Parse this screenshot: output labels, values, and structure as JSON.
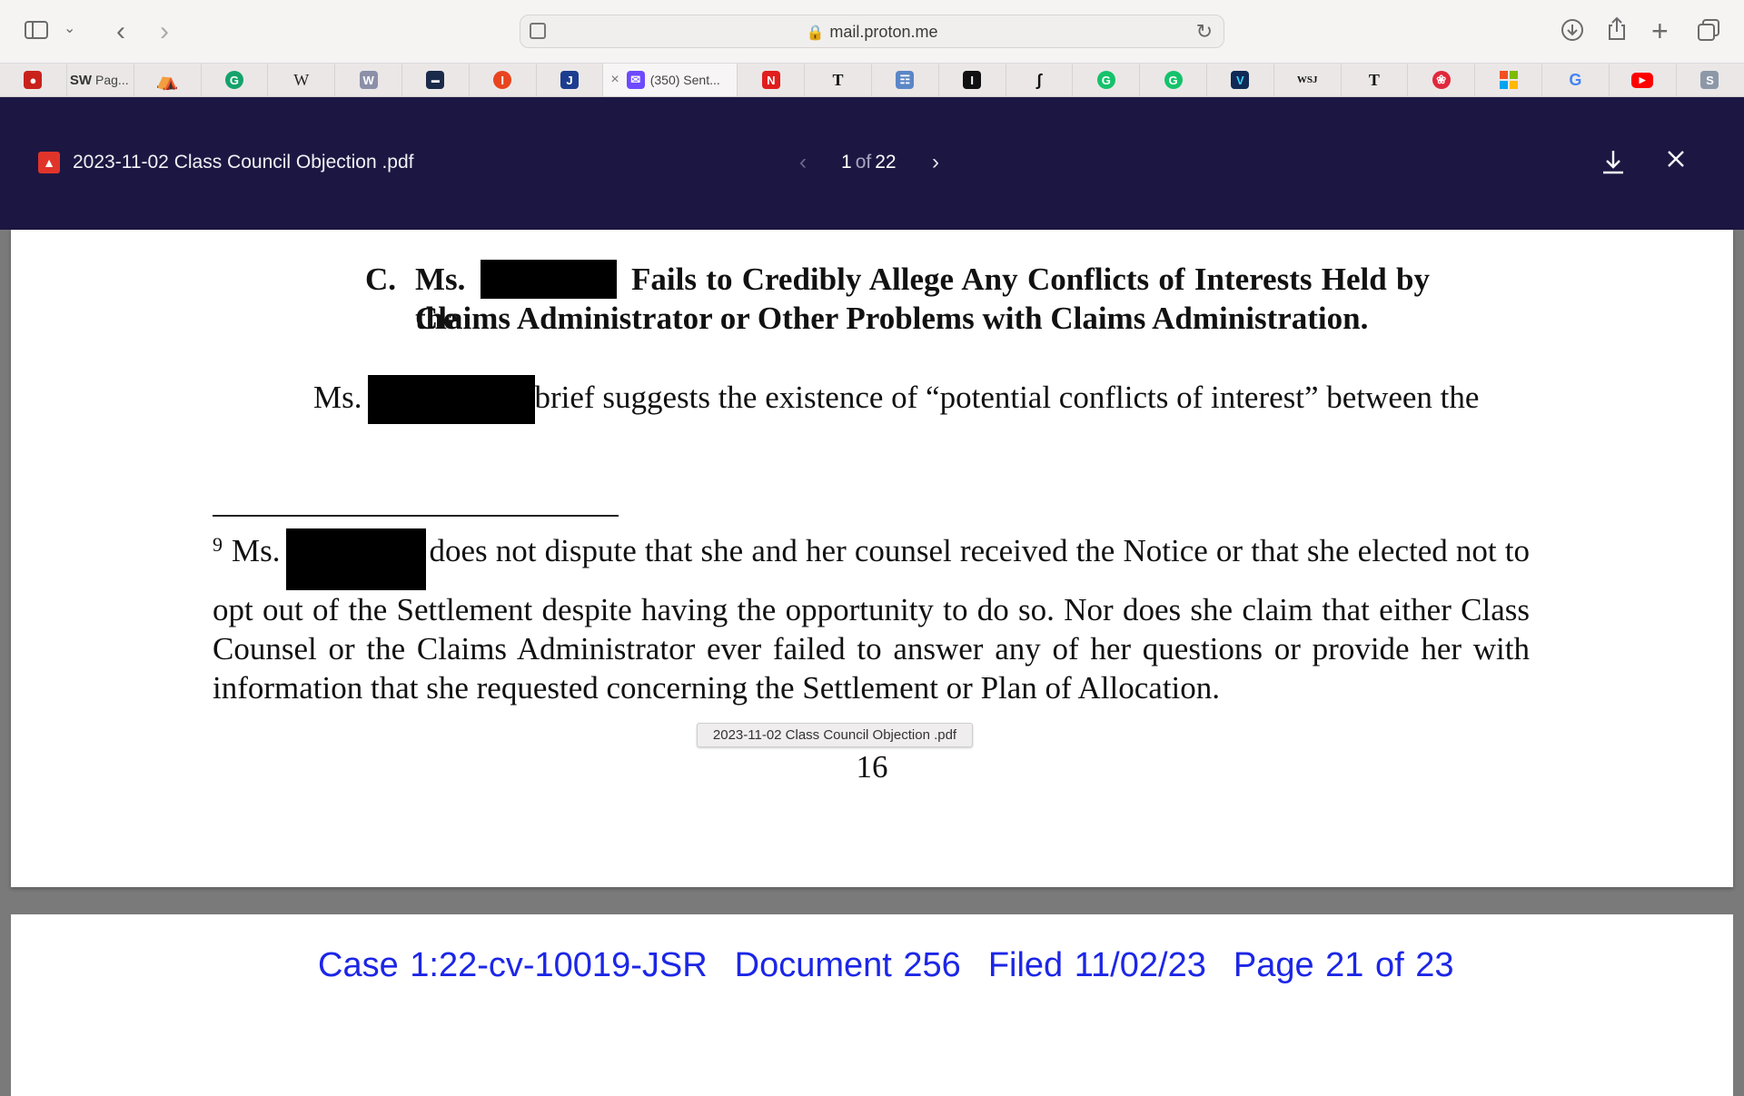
{
  "browser": {
    "url": "mail.proton.me",
    "active_tab_label": "(350) Sent...",
    "pag_tab_label": "Pag...",
    "tab_icons": [
      "S-W",
      "rainbow",
      "grammarly",
      "W",
      "W-purple",
      "bookmark",
      "I-red",
      "J",
      "proton-mail",
      "N",
      "nyt",
      "book",
      "I-black",
      "S-black",
      "grammarly",
      "grammarly",
      "V",
      "WSJ",
      "nyt",
      "yelp",
      "microsoft",
      "G",
      "youtube",
      "S-gray"
    ]
  },
  "viewer": {
    "file_name": "2023-11-02 Class Council Objection .pdf",
    "current_page": "1",
    "of_label": "of",
    "total_pages": "22"
  },
  "document": {
    "heading_number": "C.",
    "heading_line1_pre": "Ms.",
    "heading_line1_post": "Fails to Credibly Allege Any Conflicts of Interests Held by the",
    "heading_line2": "Claims Administrator or Other Problems with Claims Administration.",
    "para_pre": "Ms.",
    "para_post": "brief suggests the existence of “potential conflicts of interest” between the",
    "footnote_number": "9",
    "footnote_pre": "Ms.",
    "footnote_text": "does not dispute that she and her counsel received the Notice or that she elected not to opt out of the Settlement despite having the opportunity to do so.  Nor does she claim that either Class Counsel or the Claims Administrator ever failed to answer any of her questions or provide her with information that she requested concerning the Settlement or Plan of Allocation.",
    "page_number": "16",
    "tooltip": "2023-11-02 Class Council Objection .pdf"
  },
  "next_page_header": {
    "case": "Case 1:22-cv-10019-JSR",
    "document": "Document 256",
    "filed": "Filed 11/02/23",
    "page": "Page 21 of 23"
  },
  "colors": {
    "viewer_bar": "#1c1742",
    "header_blue": "#1c26e6",
    "pdf_badge": "#e0342a"
  }
}
